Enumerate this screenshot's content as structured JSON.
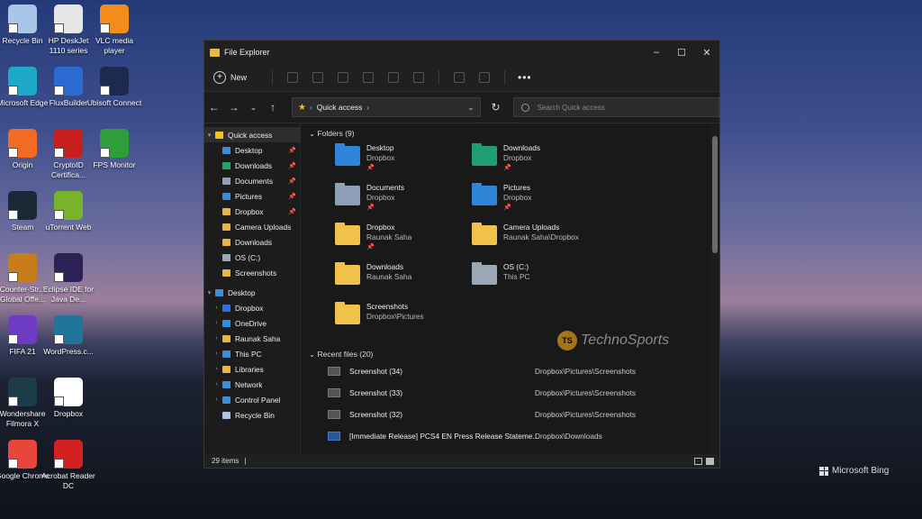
{
  "desktop": {
    "icons": [
      {
        "label": "Recycle Bin",
        "color": "#a8c6e8"
      },
      {
        "label": "HP DeskJet 1110 series",
        "color": "#e6e6e6"
      },
      {
        "label": "VLC media player",
        "color": "#f28c1b"
      },
      {
        "label": "Microsoft Edge",
        "color": "#1fa9c9"
      },
      {
        "label": "FluxBuilder",
        "color": "#2c6ad4"
      },
      {
        "label": "Ubisoft Connect",
        "color": "#1c2a52"
      },
      {
        "label": "Origin",
        "color": "#f36a22"
      },
      {
        "label": "CryptoID Certifica...",
        "color": "#c81e1e"
      },
      {
        "label": "FPS Monitor",
        "color": "#2d9e3a"
      },
      {
        "label": "Steam",
        "color": "#1b2838"
      },
      {
        "label": "uTorrent Web",
        "color": "#77b32b"
      },
      {
        "label": "Counter-Str... Global Offe...",
        "color": "#c77d1c"
      },
      {
        "label": "Eclipse IDE for Java De...",
        "color": "#2c2255"
      },
      {
        "label": "FIFA 21",
        "color": "#6d3bc4"
      },
      {
        "label": "WordPress.c...",
        "color": "#21759b"
      },
      {
        "label": "Wondershare Filmora X",
        "color": "#1d3c4a"
      },
      {
        "label": "Dropbox",
        "color": "#ffffff"
      },
      {
        "label": "Google Chrome",
        "color": "#e8453c"
      },
      {
        "label": "Acrobat Reader DC",
        "color": "#d4201f"
      }
    ],
    "bing": "Microsoft Bing"
  },
  "window": {
    "title": "File Explorer",
    "toolbar": {
      "new_label": "New",
      "more": "•••"
    },
    "address": {
      "path": "Quick access",
      "search_placeholder": "Search Quick access"
    },
    "sidebar": [
      {
        "label": "Quick access",
        "color": "#f3c318",
        "level": 0,
        "sel": true,
        "caret": "▾"
      },
      {
        "label": "Desktop",
        "color": "#3c8ed8",
        "level": 1,
        "pin": true
      },
      {
        "label": "Downloads",
        "color": "#22a36a",
        "level": 1,
        "pin": true
      },
      {
        "label": "Documents",
        "color": "#8fa2b8",
        "level": 1,
        "pin": true
      },
      {
        "label": "Pictures",
        "color": "#3d8ad6",
        "level": 1,
        "pin": true
      },
      {
        "label": "Dropbox",
        "color": "#e9b544",
        "level": 1,
        "pin": true
      },
      {
        "label": "Camera Uploads",
        "color": "#e9b544",
        "level": 1
      },
      {
        "label": "Downloads",
        "color": "#e9b544",
        "level": 1
      },
      {
        "label": "OS (C:)",
        "color": "#9aa7b5",
        "level": 1
      },
      {
        "label": "Screenshots",
        "color": "#e9b544",
        "level": 1
      },
      {
        "label": "Desktop",
        "color": "#3c8ed8",
        "level": 0,
        "caret": "▾",
        "gap": true
      },
      {
        "label": "Dropbox",
        "color": "#2f6fe0",
        "level": 1,
        "caret": "›"
      },
      {
        "label": "OneDrive",
        "color": "#2f8fe0",
        "level": 1,
        "caret": "›"
      },
      {
        "label": "Raunak Saha",
        "color": "#e9b544",
        "level": 1,
        "caret": "›"
      },
      {
        "label": "This PC",
        "color": "#3c8ed8",
        "level": 1,
        "caret": "›"
      },
      {
        "label": "Libraries",
        "color": "#e9b544",
        "level": 1,
        "caret": "›"
      },
      {
        "label": "Network",
        "color": "#3c8ed8",
        "level": 1,
        "caret": "›"
      },
      {
        "label": "Control Panel",
        "color": "#3c8ed8",
        "level": 1,
        "caret": "›"
      },
      {
        "label": "Recycle Bin",
        "color": "#a8c6e8",
        "level": 1
      }
    ],
    "folders_header": "Folders (9)",
    "folders": [
      {
        "name": "Desktop",
        "sub": "Dropbox",
        "pin": true,
        "color": "#2f86d8"
      },
      {
        "name": "Downloads",
        "sub": "Dropbox",
        "pin": true,
        "color": "#1f9d73"
      },
      {
        "name": "Documents",
        "sub": "Dropbox",
        "pin": true,
        "color": "#8ea0b8"
      },
      {
        "name": "Pictures",
        "sub": "Dropbox",
        "pin": true,
        "color": "#2f86d8"
      },
      {
        "name": "Dropbox",
        "sub": "Raunak Saha",
        "pin": true,
        "color": "#f0c24a"
      },
      {
        "name": "Camera Uploads",
        "sub": "Raunak Saha\\Dropbox",
        "pin": false,
        "color": "#f0c24a"
      },
      {
        "name": "Downloads",
        "sub": "Raunak Saha",
        "pin": false,
        "color": "#f0c24a"
      },
      {
        "name": "OS (C:)",
        "sub": "This PC",
        "pin": false,
        "color": "#9aa7b5"
      },
      {
        "name": "Screenshots",
        "sub": "Dropbox\\Pictures",
        "pin": false,
        "color": "#f0c24a"
      }
    ],
    "recent_header": "Recent files (20)",
    "recent": [
      {
        "name": "Screenshot (34)",
        "loc": "Dropbox\\Pictures\\Screenshots"
      },
      {
        "name": "Screenshot (33)",
        "loc": "Dropbox\\Pictures\\Screenshots"
      },
      {
        "name": "Screenshot (32)",
        "loc": "Dropbox\\Pictures\\Screenshots"
      },
      {
        "name": "[Immediate Release] PCS4 EN Press Release Stateme...",
        "loc": "Dropbox\\Downloads"
      }
    ],
    "status": "29 items",
    "watermark": "TechnoSports"
  }
}
